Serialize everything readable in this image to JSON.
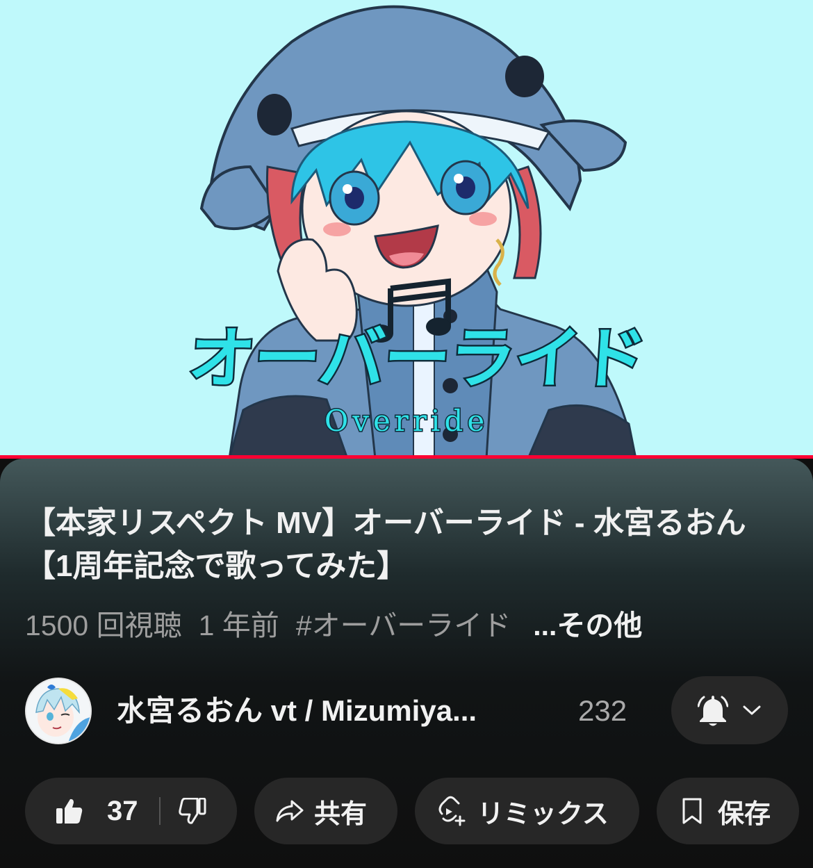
{
  "thumbnail": {
    "title_jp": "オーバーライド",
    "title_en": "Override",
    "background": "#bff9fb",
    "progress_fraction": 1.0
  },
  "video": {
    "title": "【本家リスペクト MV】オーバーライド - 水宮るおん【1周年記念で歌ってみた】",
    "views": "1500 回視聴",
    "age": "1 年前",
    "hashtag": "#オーバーライド",
    "more": "...その他"
  },
  "channel": {
    "name": "水宮るおん vt / Mizumiya...",
    "subscribers": "232",
    "bell_icon": "bell-filled-icon",
    "chevron_icon": "chevron-down-icon"
  },
  "actions": {
    "likes": "37",
    "share": "共有",
    "remix": "リミックス",
    "save": "保存"
  },
  "colors": {
    "panel_top": "#44585a",
    "pill_bg": "#272727",
    "text_primary": "#f1f1f1",
    "text_secondary": "#9e9e9e"
  }
}
